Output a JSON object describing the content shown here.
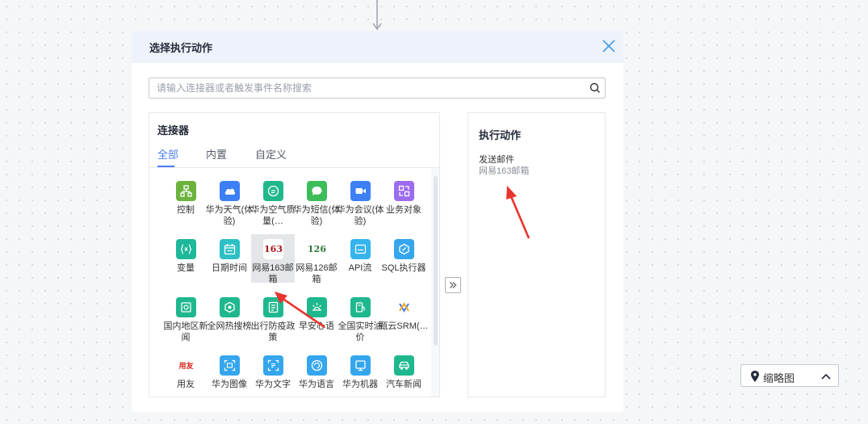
{
  "dialog": {
    "title": "选择执行动作",
    "close_icon": "close-icon"
  },
  "search": {
    "placeholder": "请输入连接器或者触发事件名称搜索",
    "value": "",
    "icon": "search-icon"
  },
  "connectors": {
    "title": "连接器",
    "tabs": [
      {
        "label": "全部",
        "active": true
      },
      {
        "label": "内置",
        "active": false
      },
      {
        "label": "自定义",
        "active": false
      }
    ],
    "items": [
      {
        "label": "控制",
        "icon": "flow-chart-icon",
        "color": "#6cb33e"
      },
      {
        "label": "华为天气(体验)",
        "icon": "cloud-icon",
        "color": "#3d7ff5"
      },
      {
        "label": "华为空气质量(…",
        "icon": "air-quality-icon",
        "color": "#20b88a"
      },
      {
        "label": "华为短信(体验)",
        "icon": "chat-bubble-icon",
        "color": "#3dbd5a"
      },
      {
        "label": "华为会议(体验)",
        "icon": "video-camera-icon",
        "color": "#3d7ff5"
      },
      {
        "label": "业务对象",
        "icon": "object-icon",
        "color": "#9b6cf0"
      },
      {
        "label": "变量",
        "icon": "variable-icon",
        "color": "#1fb89b"
      },
      {
        "label": "日期时间",
        "icon": "calendar-icon",
        "color": "#2dc0c5"
      },
      {
        "label": "网易163邮箱",
        "icon": "netease-163-logo",
        "color": "#ffffff",
        "logo_text": "163",
        "selected": true
      },
      {
        "label": "网易126邮箱",
        "icon": "netease-126-logo",
        "color": "#ffffff",
        "logo_text": "126"
      },
      {
        "label": "API流",
        "icon": "api-icon",
        "color": "#35b4ee"
      },
      {
        "label": "SQL执行器",
        "icon": "sql-icon",
        "color": "#35a6ee"
      },
      {
        "label": "国内地区新闻",
        "icon": "news-icon",
        "color": "#1fb88e"
      },
      {
        "label": "全网热搜榜",
        "icon": "hot-search-icon",
        "color": "#1fb88e"
      },
      {
        "label": "出行防疫政策",
        "icon": "policy-icon",
        "color": "#1fb88e"
      },
      {
        "label": "早安心语",
        "icon": "sunrise-icon",
        "color": "#1fb88e"
      },
      {
        "label": "全国实时油价",
        "icon": "fuel-icon",
        "color": "#1fb88e"
      },
      {
        "label": "甄云SRM(…",
        "icon": "srm-logo",
        "color": "#ffffff"
      },
      {
        "label": "用友",
        "icon": "yonyou-logo",
        "color": "#ffffff",
        "logo_text": "用友"
      },
      {
        "label": "华为图像",
        "icon": "image-scan-icon",
        "color": "#35a6ee"
      },
      {
        "label": "华为文字",
        "icon": "text-scan-icon",
        "color": "#35a6ee"
      },
      {
        "label": "华为语言",
        "icon": "language-icon",
        "color": "#35a6ee"
      },
      {
        "label": "华为机器",
        "icon": "machine-icon",
        "color": "#35a6ee"
      },
      {
        "label": "汽车新闻",
        "icon": "car-icon",
        "color": "#1fb88e"
      }
    ]
  },
  "move_button_icon": "double-chevron-right-icon",
  "actions": {
    "title": "执行动作",
    "items": [
      {
        "name": "发送邮件",
        "connector": "网易163邮箱"
      }
    ]
  },
  "minimap": {
    "label": "缩略图",
    "pin_icon": "location-pin-icon",
    "chevron_icon": "chevron-up-icon"
  },
  "colors": {
    "accent": "#4b7cf3",
    "annotation_arrow": "#e8342e"
  }
}
